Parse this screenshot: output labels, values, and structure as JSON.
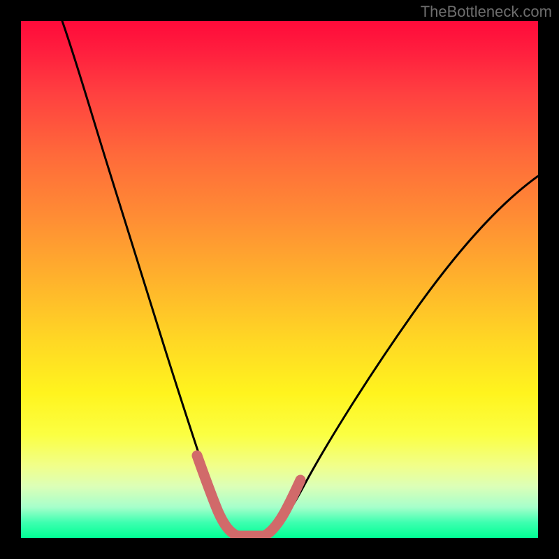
{
  "watermark": "TheBottleneck.com",
  "colors": {
    "background": "#000000",
    "curve_stroke": "#000000",
    "accent_stroke": "#d16a6a",
    "gradient_top": "#ff0a3a",
    "gradient_bottom": "#00ff94"
  },
  "chart_data": {
    "type": "line",
    "title": "",
    "xlabel": "",
    "ylabel": "",
    "x_range": [
      0,
      100
    ],
    "y_range": [
      0,
      100
    ],
    "notes": "No axis ticks or labels are visible; x and y are normalized to the plot area (0–100). The curve descends steeply from the top-left, reaches its minimum around x≈40–47 (y≈0), then rises more gradually toward the upper right. Two short pink/coral segments highlight the curve just before and after the minimum.",
    "series": [
      {
        "name": "curve",
        "x": [
          8,
          12,
          16,
          20,
          24,
          28,
          32,
          35,
          38,
          40,
          43,
          47,
          50,
          54,
          60,
          68,
          76,
          84,
          92,
          100
        ],
        "y": [
          100,
          86,
          72,
          59,
          46,
          34,
          23,
          15,
          8,
          4,
          1,
          1,
          3,
          8,
          16,
          28,
          40,
          52,
          62,
          70
        ]
      },
      {
        "name": "highlight-left",
        "x": [
          35,
          37,
          39,
          41,
          43
        ],
        "y": [
          15,
          10,
          6,
          3,
          1
        ]
      },
      {
        "name": "highlight-right",
        "x": [
          47,
          49,
          51,
          53
        ],
        "y": [
          1,
          3,
          5,
          8
        ]
      }
    ]
  }
}
